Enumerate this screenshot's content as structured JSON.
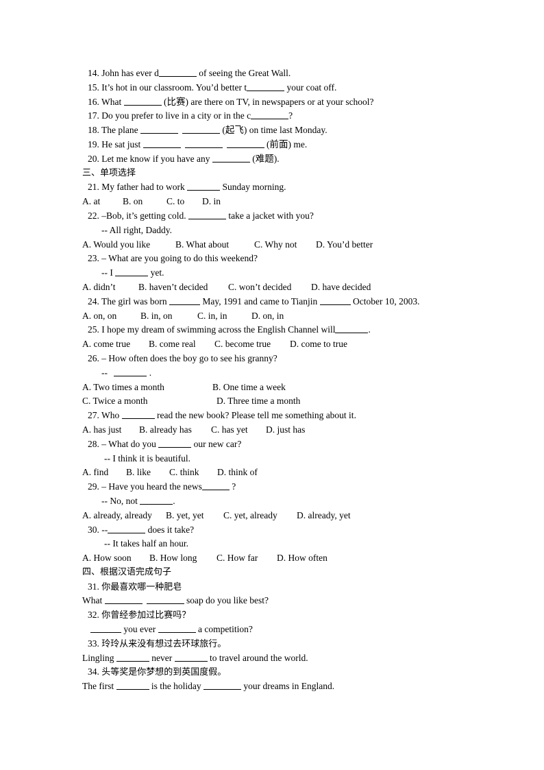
{
  "fill_in": [
    {
      "num": "14.",
      "a": "John has ever d",
      "b": " of seeing the Great Wall."
    },
    {
      "num": "15.",
      "a": "It’s hot in our classroom. You’d better t",
      "b": " your coat off."
    },
    {
      "num": "16.",
      "a": "What ",
      "b": " (比赛) are there on TV, in newspapers or at your school?"
    },
    {
      "num": "17.",
      "a": "Do you prefer to live in a city or in the c",
      "b": "?"
    },
    {
      "num": "18.",
      "a": "The plane ",
      "b": " (起飞) on time last Monday."
    },
    {
      "num": "19.",
      "a": "He sat just ",
      "b": " (前面) me."
    },
    {
      "num": "20.",
      "a": "Let me know if you have any ",
      "b": " (难题)."
    }
  ],
  "section3": "三、单项选择",
  "mc": {
    "q21": {
      "num": "21.",
      "a": "My father had to work ",
      "b": " Sunday morning.",
      "options": [
        "A. at",
        "B. on",
        "C. to",
        "D. in"
      ]
    },
    "q22": {
      "num": "22.",
      "a": "–Bob, it’s getting cold. ",
      "b": " take a jacket with you?",
      "reply": "-- All right, Daddy.",
      "options": [
        "A. Would you like",
        "B. What about",
        "C. Why not",
        "D. You’d better"
      ]
    },
    "q23": {
      "num": "23.",
      "a": "– What are you going to do this weekend?",
      "reply_a": "-- I ",
      "reply_b": " yet.",
      "options": [
        "A. didn’t",
        "B. haven’t decided",
        "C. won’t decided",
        "D. have decided"
      ]
    },
    "q24": {
      "num": "24.",
      "a": "The girl was born ",
      "b": " May, 1991 and came to Tianjin ",
      "c": " October 10, 2003.",
      "options": [
        "A. on, on",
        "B. in, on",
        "C. in, in",
        "D. on, in"
      ]
    },
    "q25": {
      "num": "25.",
      "a": "I hope my dream of swimming across the English Channel will",
      "b": ".",
      "options": [
        "A. come true",
        "B. come real",
        "C. become true",
        "D. come to true"
      ]
    },
    "q26": {
      "num": "26.",
      "a": "– How often does the boy go to see his granny?",
      "reply_a": "-- ",
      "reply_b": " .",
      "options": [
        "A. Two times a month",
        "B. One time a week",
        "C. Twice a month",
        "D. Three time a month"
      ]
    },
    "q27": {
      "num": "27.",
      "a": "Who ",
      "b": " read the new book? Please tell me something about it.",
      "options": [
        "A. has just",
        "B. already has",
        "C. has yet",
        "D. just has"
      ]
    },
    "q28": {
      "num": "28.",
      "a": "– What do you ",
      "b": " our new car?",
      "reply": "-- I think it is beautiful.",
      "options": [
        "A. find",
        "B. like",
        "C. think",
        "D. think of"
      ]
    },
    "q29": {
      "num": "29.",
      "a": "– Have you heard the news",
      "b": " ?",
      "reply_a": "-- No, not ",
      "reply_b": ".",
      "options": [
        "A. already, already",
        "B. yet, yet",
        "C. yet, already",
        "D. already, yet"
      ]
    },
    "q30": {
      "num": "30.",
      "a": "--",
      "b": " does it take?",
      "reply": "-- It takes half an hour.",
      "options": [
        "A. How soon",
        "B. How long",
        "C. How far",
        "D. How often"
      ]
    }
  },
  "section4": "四、根据汉语完成句子",
  "translate": {
    "q31": {
      "num": "31.",
      "zh": "你最喜欢哪一种肥皂",
      "a": "What ",
      "b": " soap do you like best?"
    },
    "q32": {
      "num": "32.",
      "zh": "你曾经参加过比赛吗？",
      "a": " you ever ",
      "b": " a competition?"
    },
    "q33": {
      "num": "33.",
      "zh": "玲玲从来没有想过去环球旅行。",
      "a": "Lingling ",
      "b": " never ",
      "c": " to travel around the world."
    },
    "q34": {
      "num": "34.",
      "zh": "头等奖是你梦想的到英国度假。",
      "a": "The first ",
      "b": " is the holiday ",
      "c": " your dreams in England."
    }
  }
}
